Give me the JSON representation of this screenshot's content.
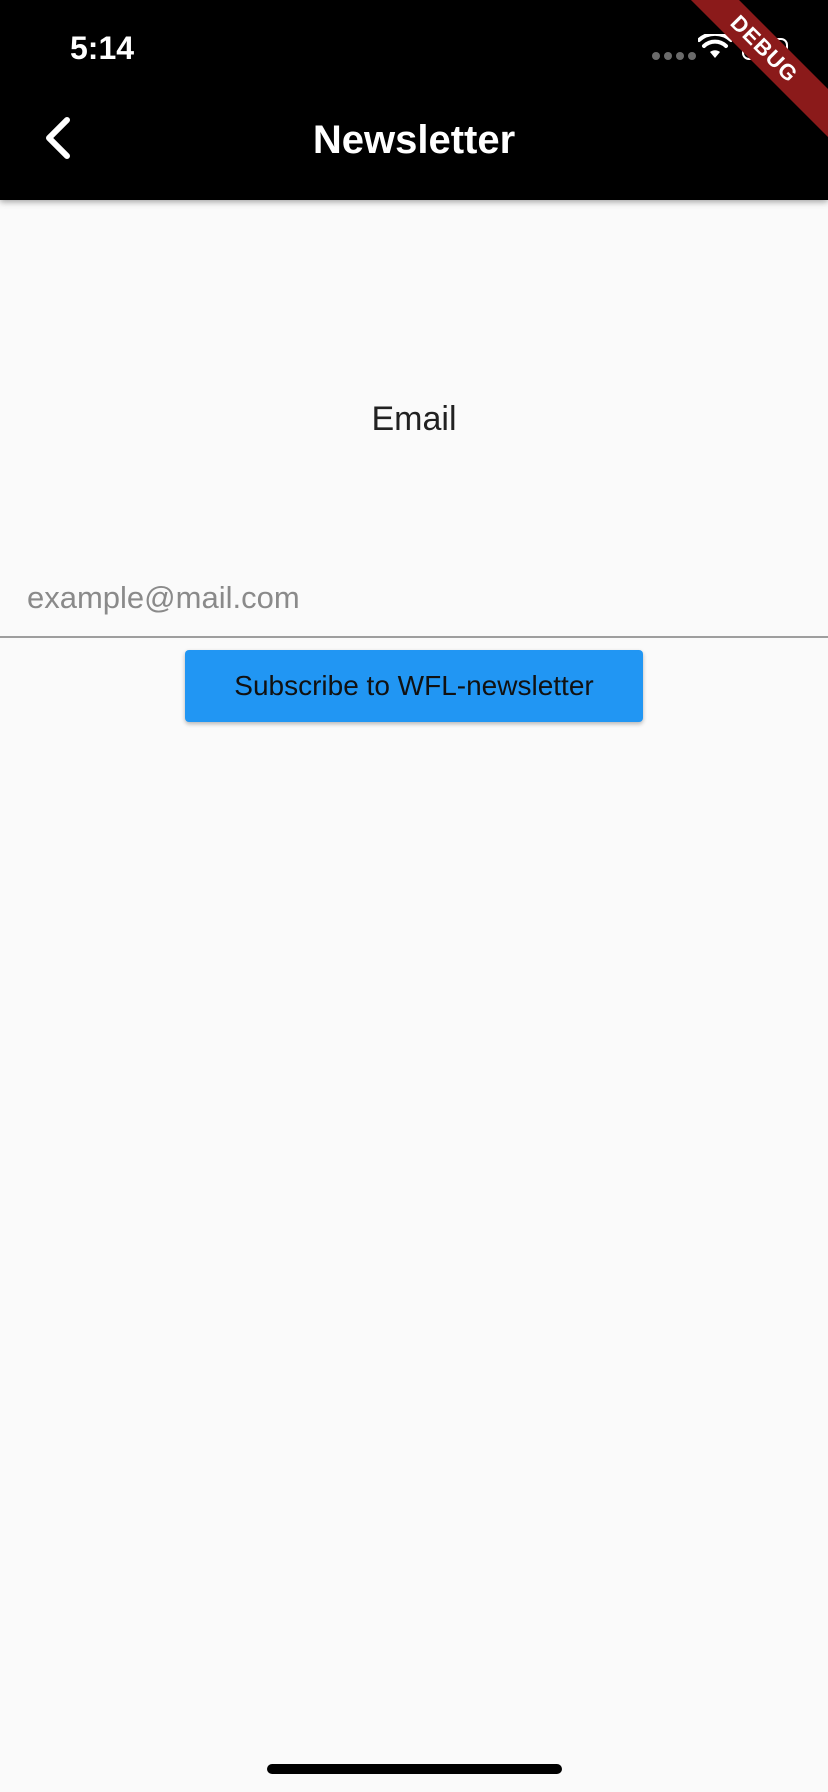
{
  "status_bar": {
    "time": "5:14"
  },
  "app_bar": {
    "title": "Newsletter",
    "back_icon": "chevron-left-icon",
    "background": "#000000"
  },
  "debug_banner": {
    "text": "DEBUG",
    "color": "#8b1a1a"
  },
  "form": {
    "email_label": "Email",
    "email_placeholder": "example@mail.com",
    "email_value": "",
    "subscribe_label": "Subscribe to WFL-newsletter",
    "button_color": "#2196f3"
  }
}
